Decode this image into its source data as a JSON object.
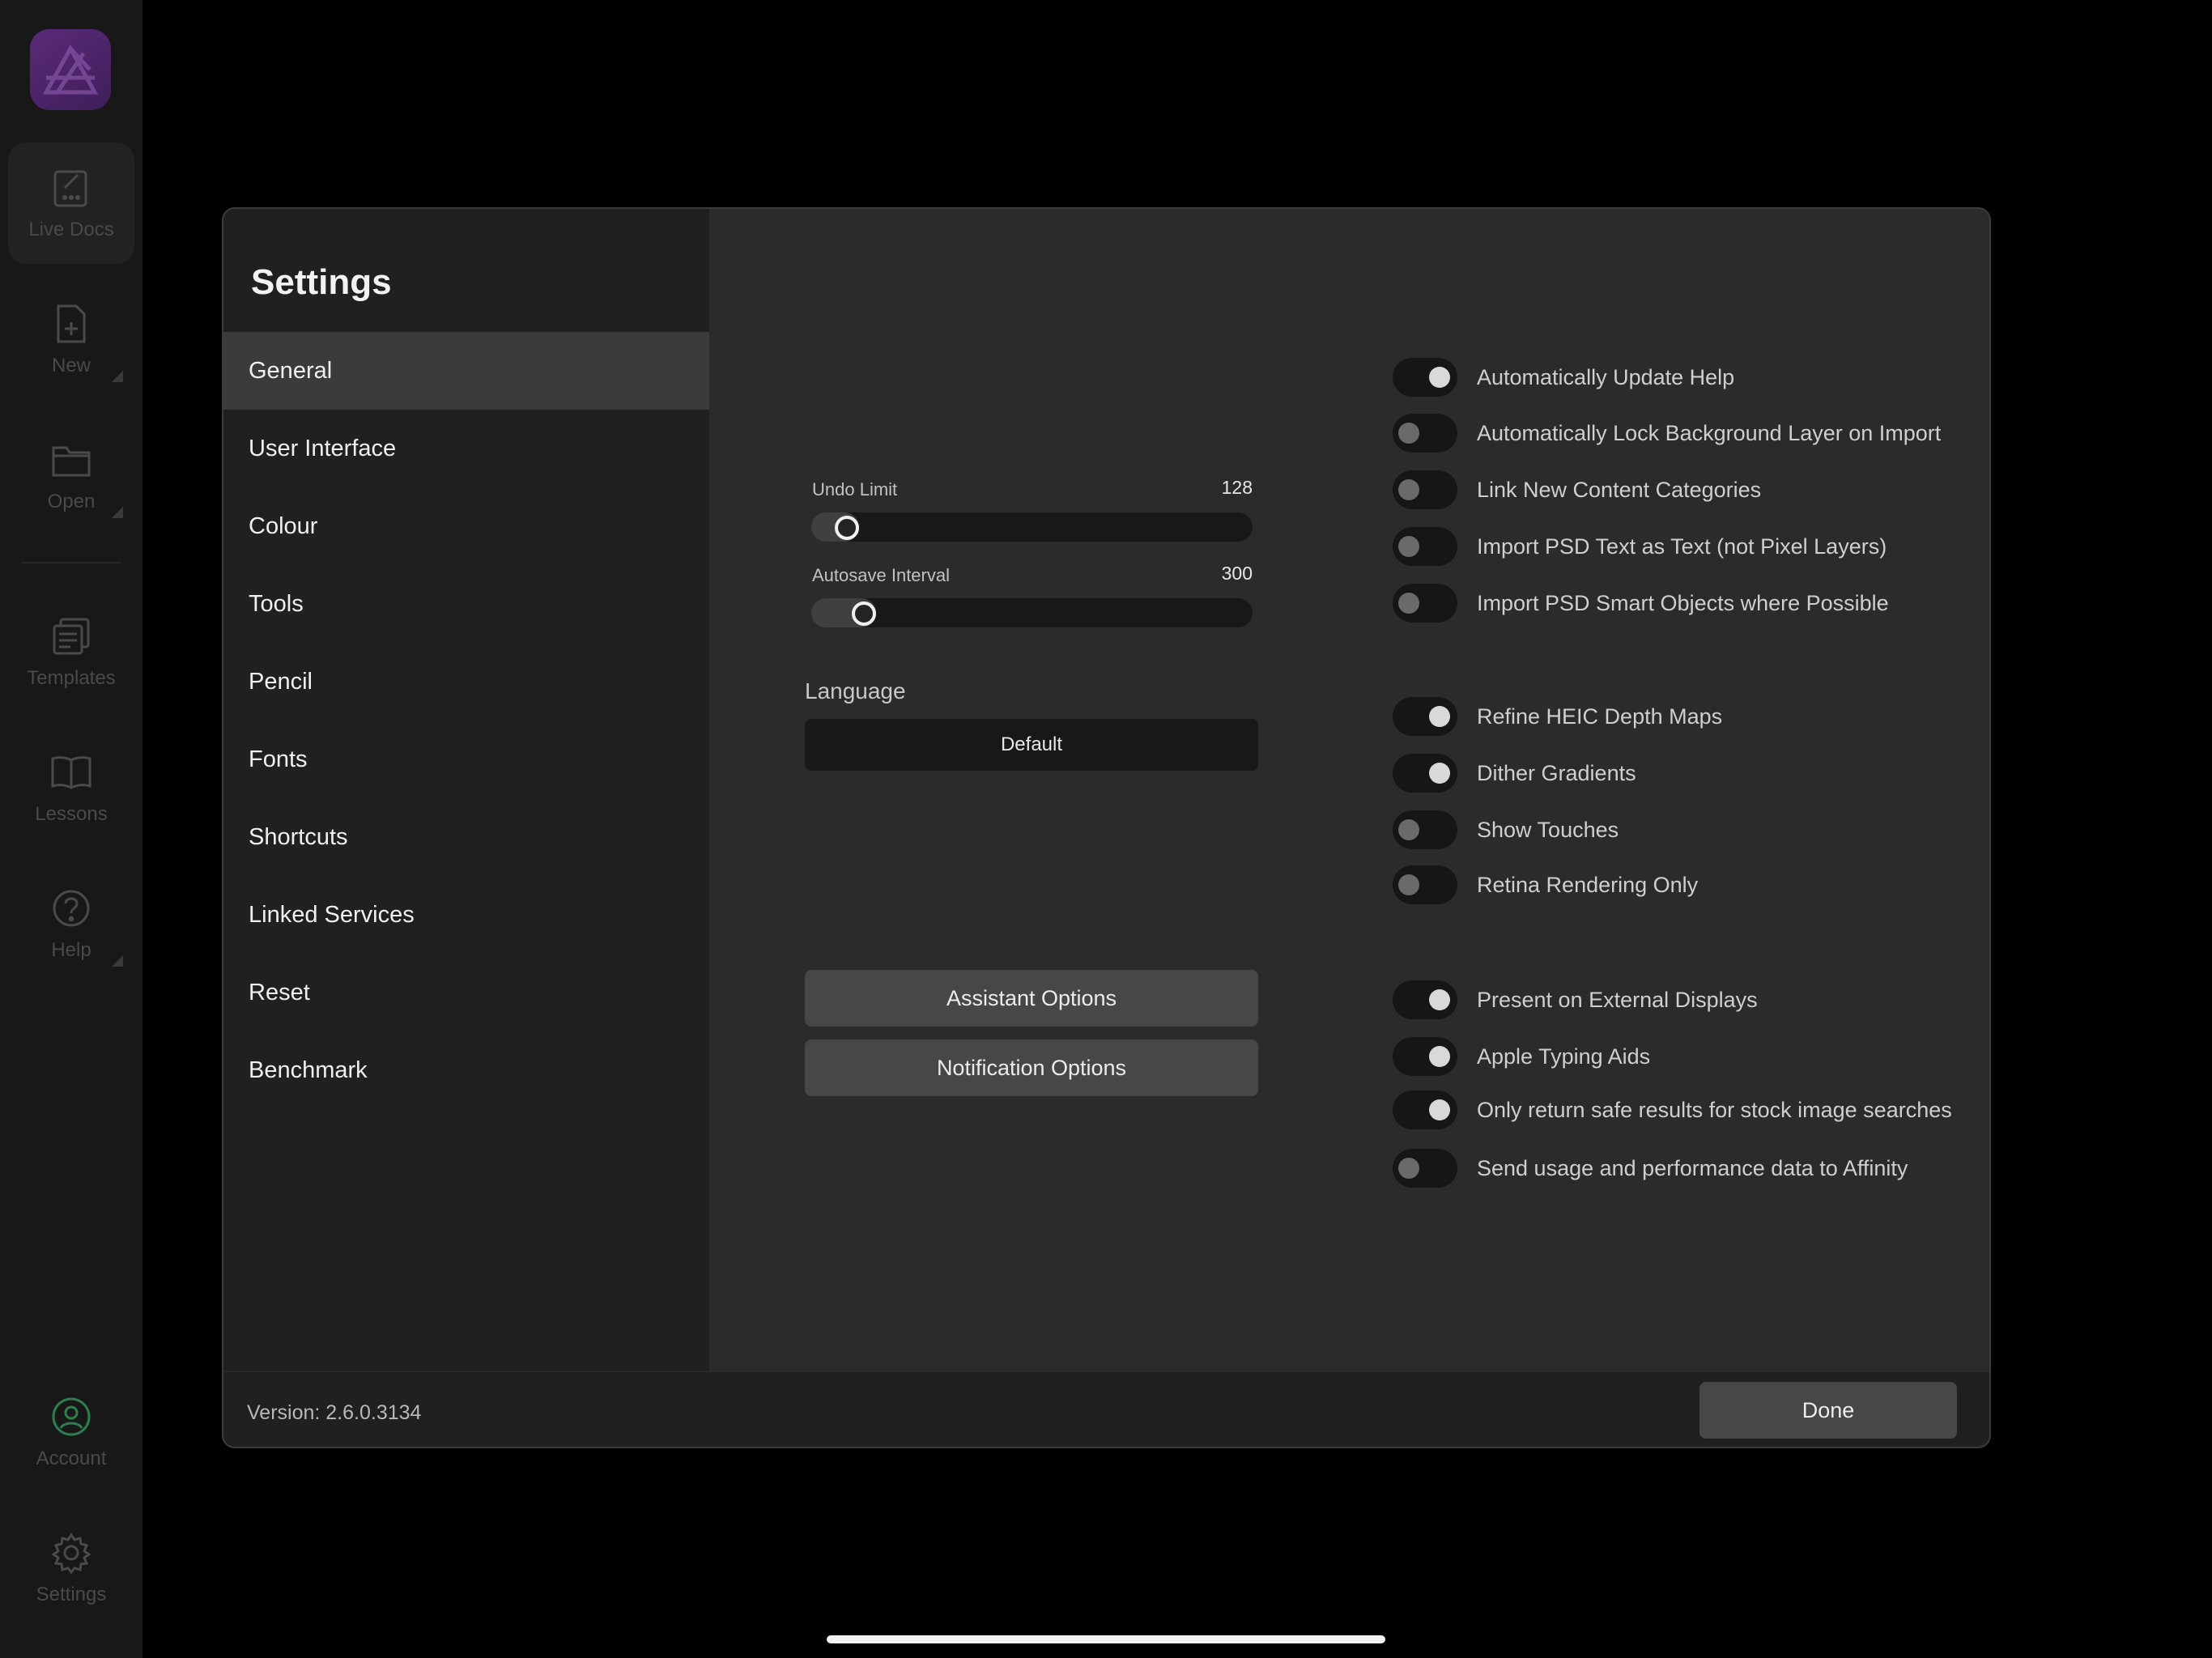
{
  "rail": {
    "items": [
      {
        "label": "Live Docs",
        "icon": "live-docs-icon",
        "active": true
      },
      {
        "label": "New",
        "icon": "new-document-icon",
        "has_menu": true
      },
      {
        "label": "Open",
        "icon": "folder-icon",
        "has_menu": true
      },
      {
        "label": "Templates",
        "icon": "templates-icon"
      },
      {
        "label": "Lessons",
        "icon": "book-icon"
      },
      {
        "label": "Help",
        "icon": "help-icon",
        "has_menu": true
      },
      {
        "label": "Account",
        "icon": "account-icon"
      },
      {
        "label": "Settings",
        "icon": "gear-icon"
      }
    ]
  },
  "dialog": {
    "title": "Settings",
    "nav": [
      {
        "label": "General",
        "active": true
      },
      {
        "label": "User Interface"
      },
      {
        "label": "Colour"
      },
      {
        "label": "Tools"
      },
      {
        "label": "Pencil"
      },
      {
        "label": "Fonts"
      },
      {
        "label": "Shortcuts"
      },
      {
        "label": "Linked Services"
      },
      {
        "label": "Reset"
      },
      {
        "label": "Benchmark"
      }
    ],
    "sliders": [
      {
        "label": "Undo Limit",
        "value": "128",
        "fraction": 0.08
      },
      {
        "label": "Autosave Interval",
        "value": "300",
        "fraction": 0.12
      }
    ],
    "language": {
      "label": "Language",
      "value": "Default"
    },
    "buttons": {
      "assistant": "Assistant Options",
      "notification": "Notification Options",
      "done": "Done"
    },
    "toggles": [
      {
        "label": "Automatically Update Help",
        "on": true
      },
      {
        "label": "Automatically Lock Background Layer on Import",
        "on": false
      },
      {
        "label": "Link New Content Categories",
        "on": false
      },
      {
        "label": "Import PSD Text as Text (not Pixel Layers)",
        "on": false
      },
      {
        "label": "Import PSD Smart Objects where Possible",
        "on": false
      },
      {
        "label": "Refine HEIC Depth Maps",
        "on": true
      },
      {
        "label": "Dither Gradients",
        "on": true
      },
      {
        "label": "Show Touches",
        "on": false
      },
      {
        "label": "Retina Rendering Only",
        "on": false
      },
      {
        "label": "Present on External Displays",
        "on": true
      },
      {
        "label": "Apple Typing Aids",
        "on": true
      },
      {
        "label": "Only return safe results for stock image searches",
        "on": true
      },
      {
        "label": "Send usage and performance data to Affinity",
        "on": false
      }
    ],
    "version": "Version: 2.6.0.3134"
  },
  "colors": {
    "accent_account": "#2e7d4f",
    "logo": "#5a2a78"
  }
}
